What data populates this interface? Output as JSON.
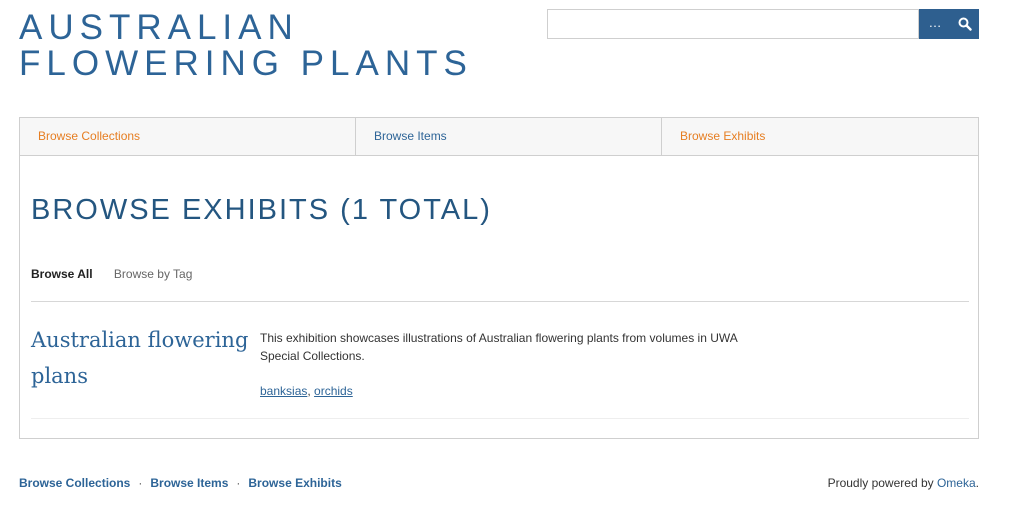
{
  "site": {
    "title_line1": "AUSTRALIAN",
    "title_line2": "FLOWERING PLANTS"
  },
  "search": {
    "placeholder": "",
    "advanced_label": "…",
    "submit_icon": "search-icon"
  },
  "nav": {
    "items": [
      {
        "label": "Browse Collections"
      },
      {
        "label": "Browse Items"
      },
      {
        "label": "Browse Exhibits"
      }
    ]
  },
  "main": {
    "heading": "BROWSE EXHIBITS (1 TOTAL)",
    "subnav": {
      "active": "Browse All",
      "other": "Browse by Tag"
    },
    "exhibit": {
      "title": "Australian flowering plans",
      "description": "This exhibition showcases illustrations of Australian flowering plants from volumes in UWA Special Collections.",
      "tags": [
        "banksias",
        "orchids"
      ],
      "tag_separator": ", "
    }
  },
  "footer": {
    "nav": [
      "Browse Collections",
      "Browse Items",
      "Browse Exhibits"
    ],
    "separator": "·",
    "powered_prefix": "Proudly powered by ",
    "powered_link": "Omeka",
    "powered_suffix": "."
  },
  "colors": {
    "brand_blue": "#2d6497",
    "heading_blue": "#245680",
    "nav_orange": "#e67e22",
    "search_button": "#2e5f8f"
  }
}
